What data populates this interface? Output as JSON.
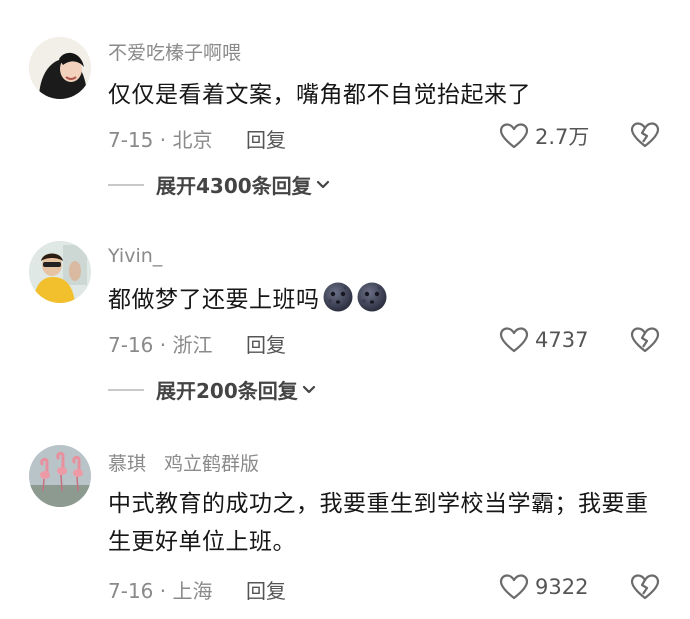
{
  "comments": [
    {
      "username": "不爱吃榛子啊喂",
      "badge": "",
      "text": "仅仅是看着文案，嘴角都不自觉抬起来了",
      "date_location": "7-15 · 北京",
      "reply_label": "回复",
      "likes": "2.7万",
      "replies_label": "展开4300条回复"
    },
    {
      "username": "Yivin_",
      "badge": "",
      "text": "都做梦了还要上班吗",
      "emojis": [
        "dark-moon-face-emoji",
        "dark-moon-face-emoji"
      ],
      "date_location": "7-16 · 浙江",
      "reply_label": "回复",
      "likes": "4737",
      "replies_label": "展开200条回复"
    },
    {
      "username": "慕琪",
      "badge": "鸡立鹤群版",
      "text": "中式教育的成功之，我要重生到学校当学霸；我要重生更好单位上班。",
      "date_location": "7-16 · 上海",
      "reply_label": "回复",
      "likes": "9322"
    }
  ]
}
